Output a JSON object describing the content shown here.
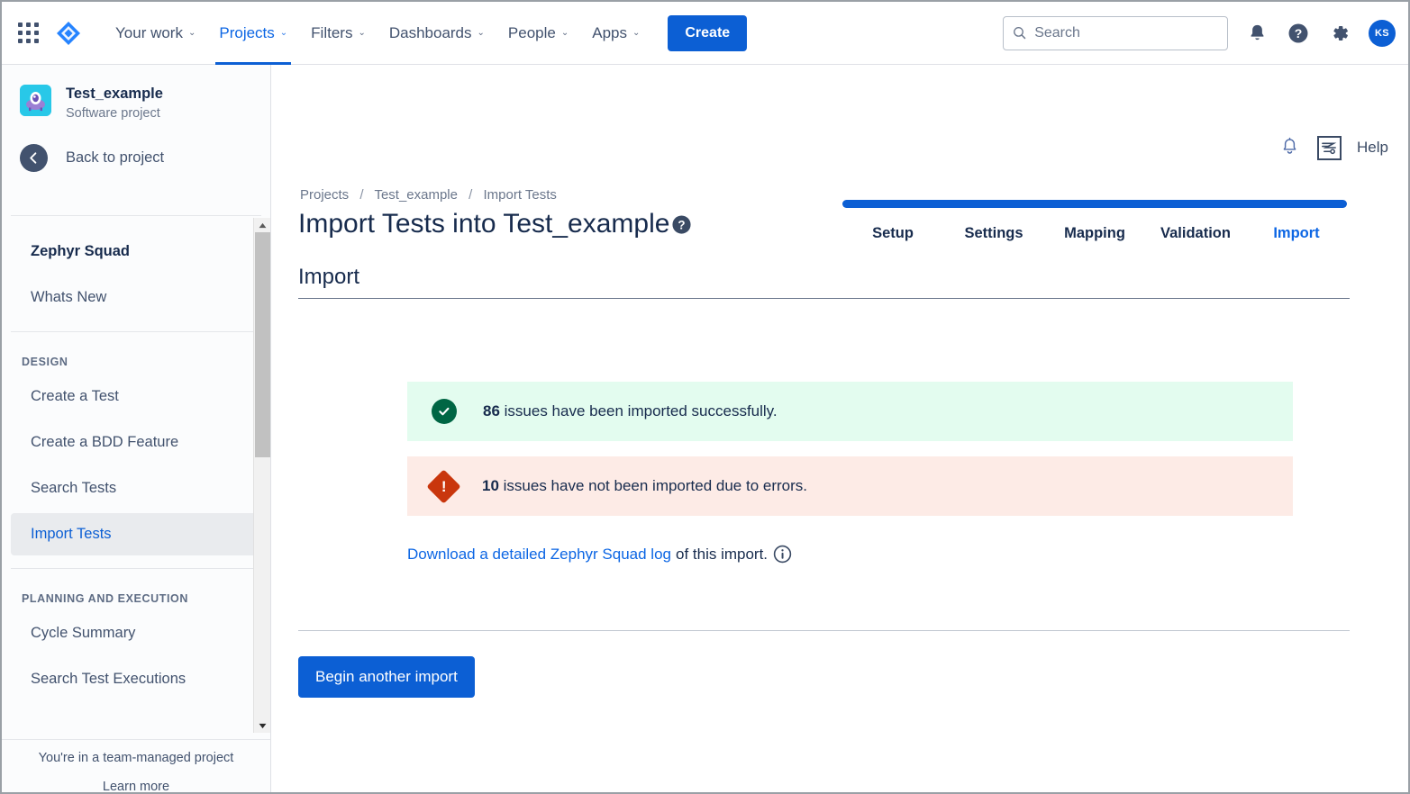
{
  "topnav": {
    "apps_icon": "apps-grid-icon",
    "logo_icon": "jira-logo-icon",
    "items": [
      {
        "label": "Your work",
        "caret": "⌄",
        "active": false
      },
      {
        "label": "Projects",
        "caret": "⌄",
        "active": true
      },
      {
        "label": "Filters",
        "caret": "⌄",
        "active": false
      },
      {
        "label": "Dashboards",
        "caret": "⌄",
        "active": false
      },
      {
        "label": "People",
        "caret": "⌄",
        "active": false
      },
      {
        "label": "Apps",
        "caret": "⌄",
        "active": false
      }
    ],
    "create_label": "Create",
    "search": {
      "placeholder": "Search",
      "value": "",
      "icon": "search-icon"
    },
    "notifications_icon": "notifications-bell-icon",
    "help_icon": "help-circle-icon",
    "settings_icon": "gear-icon",
    "avatar_initials": "KS"
  },
  "sidebar": {
    "project_name": "Test_example",
    "project_type": "Software project",
    "project_avatar_icon": "project-robot-icon",
    "back_label": "Back to project",
    "back_icon": "arrow-left-icon",
    "app_name": "Zephyr Squad",
    "whats_new": "Whats New",
    "sections": [
      {
        "title": "DESIGN",
        "items": [
          {
            "label": "Create a Test",
            "selected": false
          },
          {
            "label": "Create a BDD Feature",
            "selected": false
          },
          {
            "label": "Search Tests",
            "selected": false
          },
          {
            "label": "Import Tests",
            "selected": true
          }
        ]
      },
      {
        "title": "PLANNING AND EXECUTION",
        "items": [
          {
            "label": "Cycle Summary",
            "selected": false
          },
          {
            "label": "Search Test Executions",
            "selected": false
          }
        ]
      }
    ],
    "footer_note": "You're in a team-managed project",
    "footer_link": "Learn more",
    "scroll_up_icon": "scroll-up-arrow-icon",
    "scroll_down_icon": "scroll-down-arrow-icon"
  },
  "main": {
    "bell_icon": "notifications-bell-icon",
    "zephyr_icon": "zephyr-squad-icon",
    "help_label": "Help",
    "breadcrumb": {
      "items": [
        "Projects",
        "Test_example",
        "Import Tests"
      ],
      "separator": "/"
    },
    "page_title": "Import Tests into Test_example",
    "title_help_icon": "help-circle-icon",
    "progress": {
      "percent": 100,
      "steps": [
        {
          "label": "Setup",
          "active": false
        },
        {
          "label": "Settings",
          "active": false
        },
        {
          "label": "Mapping",
          "active": false
        },
        {
          "label": "Validation",
          "active": false
        },
        {
          "label": "Import",
          "active": true
        }
      ]
    },
    "section_title": "Import",
    "alerts": [
      {
        "type": "success",
        "icon": "check-circle-icon",
        "count": "86",
        "message": " issues have been imported successfully."
      },
      {
        "type": "error",
        "icon": "error-diamond-icon",
        "count": "10",
        "message": " issues have not been imported due to errors."
      }
    ],
    "download": {
      "link_text": "Download a detailed Zephyr Squad log",
      "tail_text": "of this import.",
      "info_icon": "info-circle-icon"
    },
    "begin_button": "Begin another import"
  },
  "colors": {
    "brand_blue": "#0c5fd4",
    "link_blue": "#0c66e4",
    "success_bg": "#e3fcef",
    "success_fg": "#006644",
    "error_bg": "#fdebe6",
    "error_fg": "#c9360d",
    "text": "#172b4d",
    "muted": "#6b778c"
  }
}
